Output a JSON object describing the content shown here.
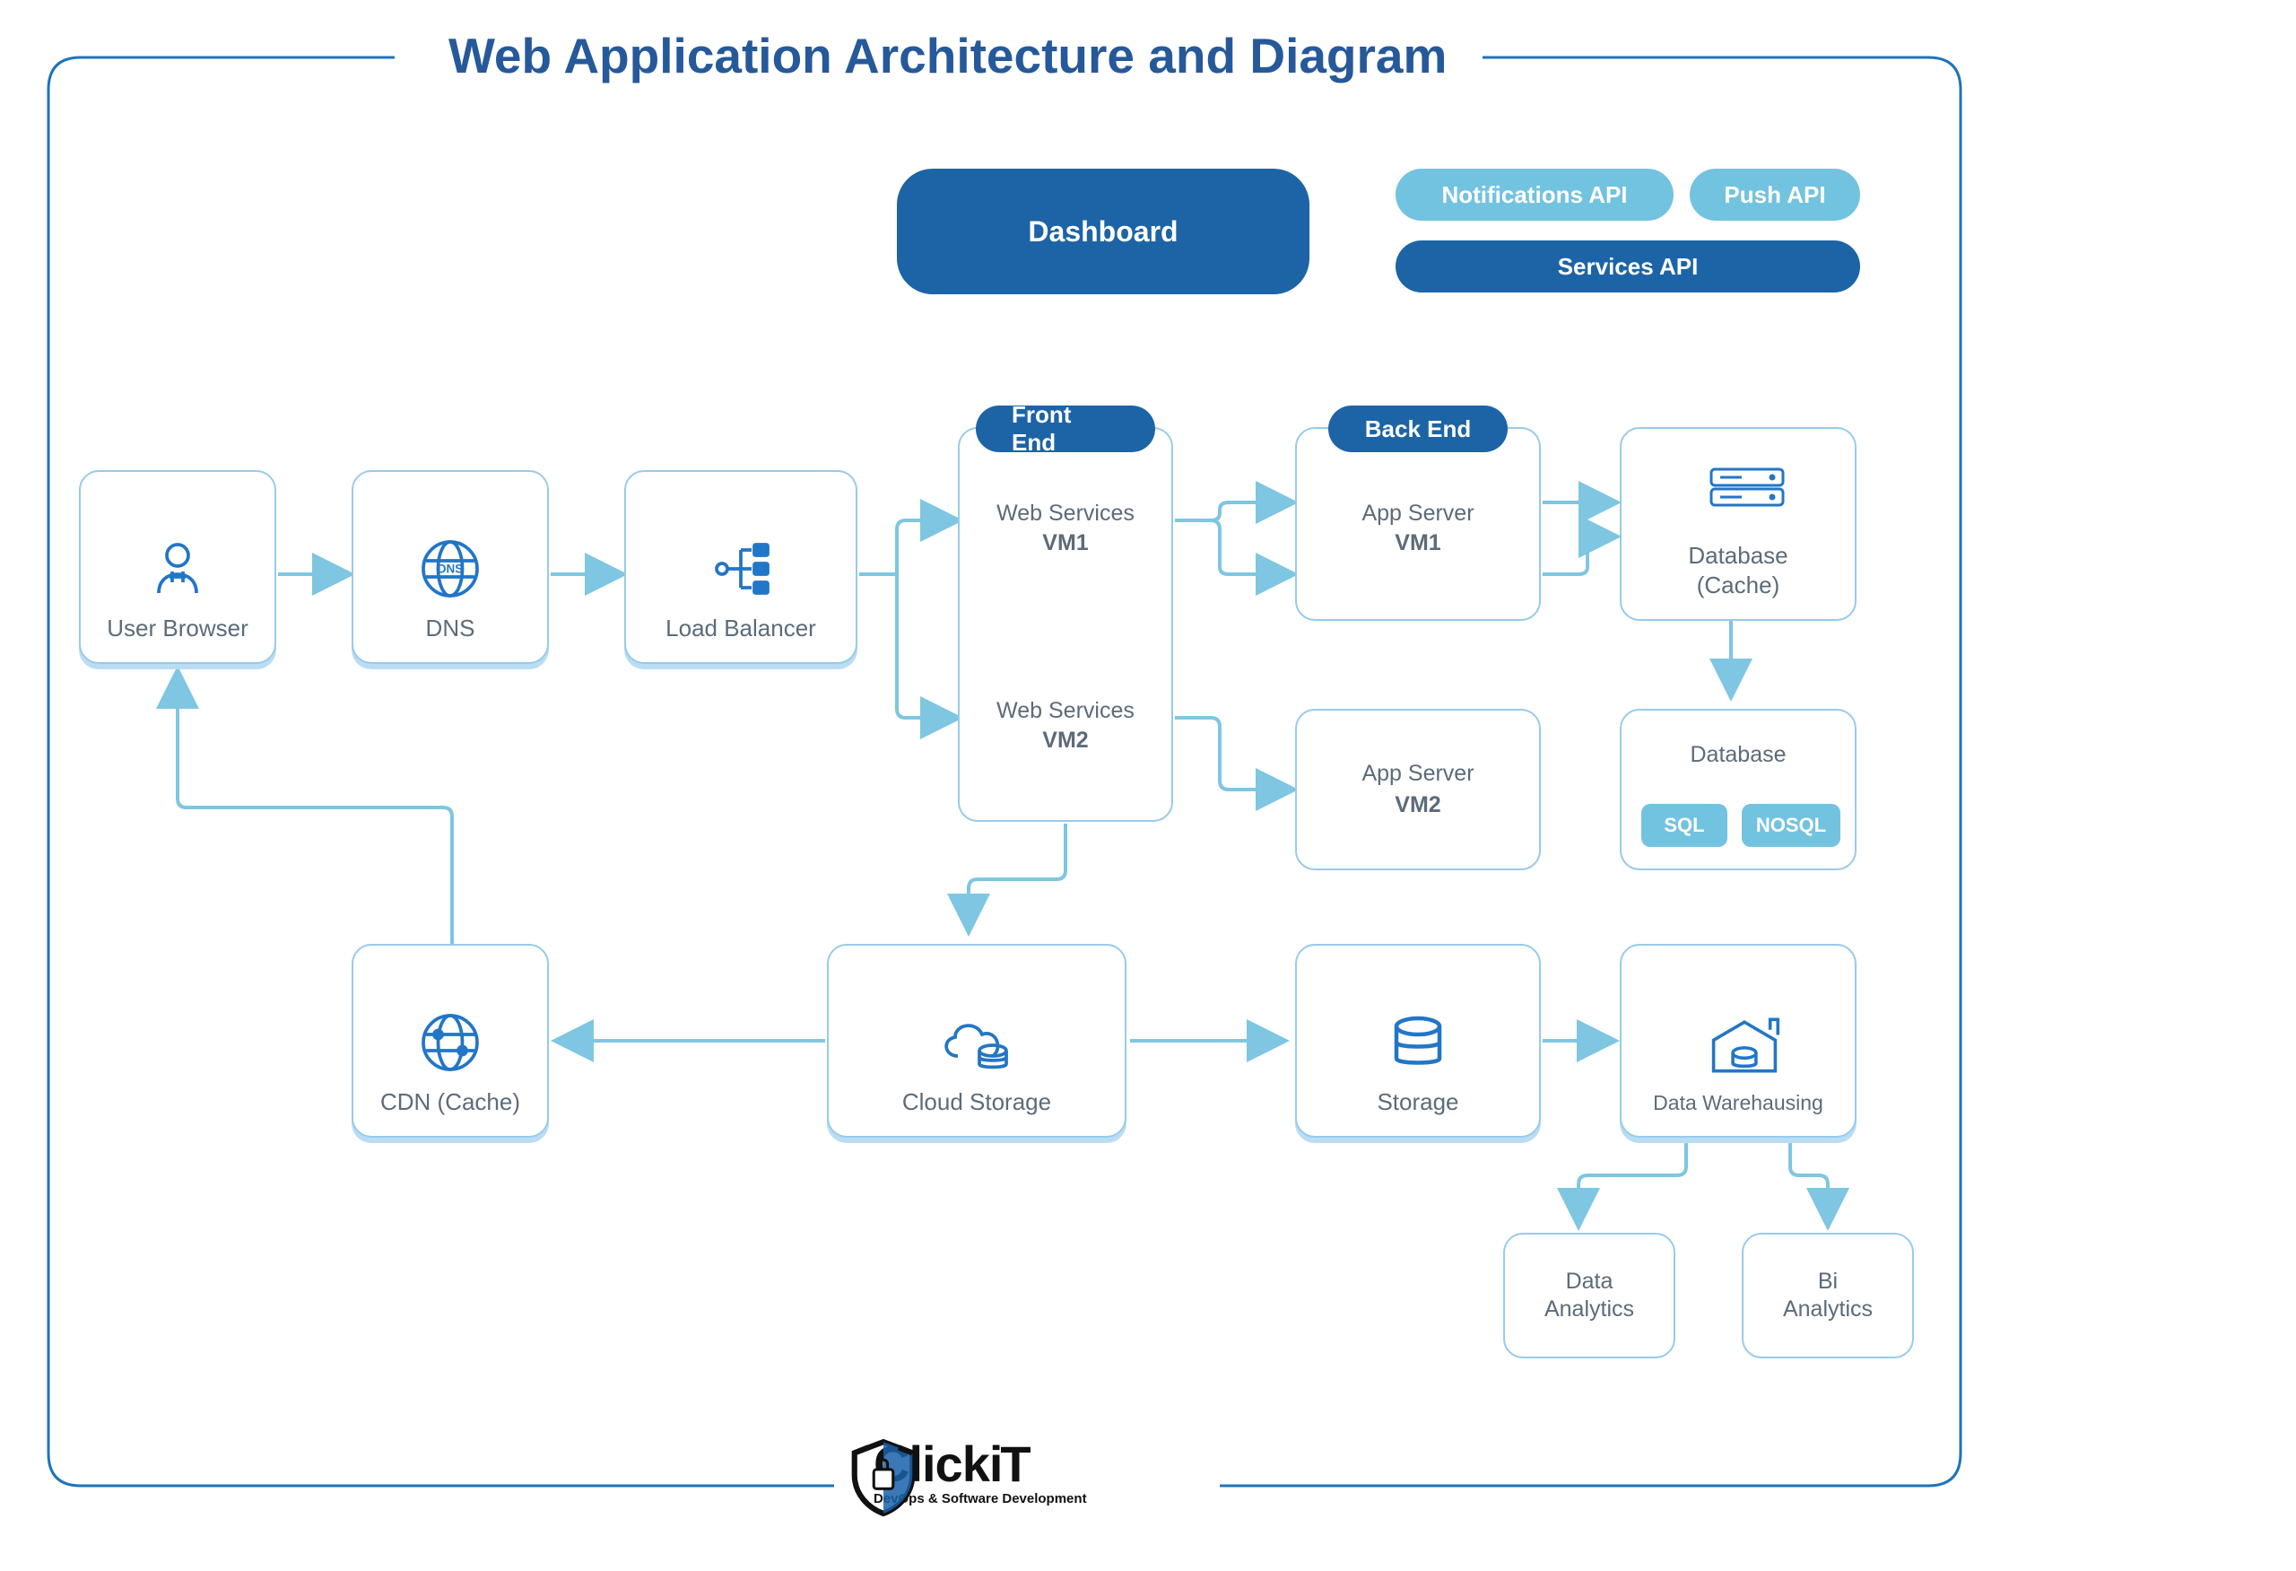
{
  "title": "Web Application Architecture and Diagram",
  "top": {
    "dashboard": "Dashboard",
    "notifications": "Notifications API",
    "push": "Push API",
    "services": "Services API"
  },
  "sections": {
    "frontend": "Front End",
    "backend": "Back End"
  },
  "nodes": {
    "user": "User Browser",
    "dns": "DNS",
    "lb": "Load Balancer",
    "ws1_l1": "Web Services",
    "ws1_l2": "VM1",
    "ws2_l1": "Web Services",
    "ws2_l2": "VM2",
    "as1_l1": "App Server",
    "as1_l2": "VM1",
    "as2_l1": "App Server",
    "as2_l2": "VM2",
    "dbcache_l1": "Database",
    "dbcache_l2": "(Cache)",
    "db": "Database",
    "sql": "SQL",
    "nosql": "NOSQL",
    "cdn": "CDN (Cache)",
    "cloud": "Cloud Storage",
    "storage": "Storage",
    "dw": "Data Warehausing",
    "da": "Data\nAnalytics",
    "bi": "Bi\nAnalytics"
  },
  "logo": {
    "main": "ClickiT",
    "sub": "DevOps & Software Development"
  }
}
